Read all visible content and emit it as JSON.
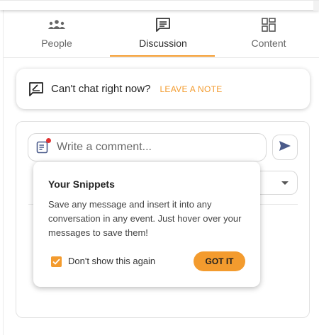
{
  "tabs": [
    {
      "label": "People",
      "icon": "people-icon",
      "active": false
    },
    {
      "label": "Discussion",
      "icon": "discussion-icon",
      "active": true
    },
    {
      "label": "Content",
      "icon": "content-grid-icon",
      "active": false
    }
  ],
  "note": {
    "text": "Can't chat right now?",
    "link": "LEAVE A NOTE",
    "icon": "note-pen-icon"
  },
  "comment": {
    "placeholder": "Write a comment...",
    "icon": "snippets-icon",
    "send_icon": "send-icon"
  },
  "select": {
    "icon": "chevron-down-icon"
  },
  "popover": {
    "title": "Your Snippets",
    "body": "Save any message and insert it into any conversation in any event. Just hover over your messages to save them!",
    "checkbox_label": "Don't show this again",
    "checkbox_checked": true,
    "button_label": "GOT IT"
  },
  "colors": {
    "accent": "#f39b2e",
    "text": "#2b2b2b",
    "notification_dot": "#e03131"
  }
}
